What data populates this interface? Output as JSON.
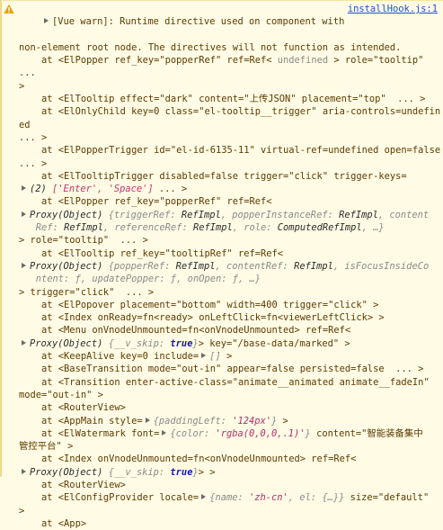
{
  "warning": {
    "line1": "[Vue warn]: Runtime directive used on component with",
    "source_link": "installHook.js:1",
    "line2": "non-element root node. The directives will not function as intended."
  },
  "trace": {
    "r1_pre": "at <ElPopper ref_key=\"popperRef\" ref=Ref< ",
    "r1_und": "undefined",
    "r1_post": " > role=\"tooltip\"  ...",
    "r1_cont": ">",
    "r2": "at <ElTooltip effect=\"dark\" content=\"上传JSON\" placement=\"top\"  ... >",
    "r3a": "at <ElOnlyChild key=0 class=\"el-tooltip__trigger\" aria-controls=undefined",
    "r3b": "... >",
    "r4a": "at <ElPopperTrigger id=\"el-id-6135-11\" virtual-ref=undefined open=false",
    "r4b": "... >",
    "r5a": "at <ElTooltipTrigger disabled=false trigger=\"click\" trigger-keys=",
    "r5_count": "(2)",
    "r5_items": "['Enter', 'Space']",
    "r5_post": " ... >",
    "r6": "at <ElPopper ref_key=\"popperRef\" ref=Ref<",
    "r6_proxy": "Proxy(Object)",
    "r6_o1": "{triggerRef: ",
    "r6_o1v": "RefImpl",
    "r6_o2": ", popperInstanceRef: ",
    "r6_o2v": "RefImpl",
    "r6_o3": ", content",
    "r6_o4": "Ref: ",
    "r6_o4v": "RefImpl",
    "r6_o5": ", referenceRef: ",
    "r6_o5v": "RefImpl",
    "r6_o6": ", role: ",
    "r6_o6v": "ComputedRefImpl",
    "r6_o7": ", …}",
    "r6_post": "> role=\"tooltip\"  ... >",
    "r7": "at <ElTooltip ref_key=\"tooltipRef\" ref=Ref<",
    "r7_proxy": "Proxy(Object)",
    "r7_o1": "{popperRef: ",
    "r7_o1v": "RefImpl",
    "r7_o2": ", contentRef: ",
    "r7_o2v": "RefImpl",
    "r7_o3": ", isFocusInsideCo",
    "r7_o4": "ntent: ƒ, updatePopper: ƒ, onOpen: ƒ, …}",
    "r7_post": "> trigger=\"click\"  ... >",
    "r8": "at <ElPopover placement=\"bottom\" width=400 trigger=\"click\" >",
    "r9": "at <Index onReady=fn<ready> onLeftClick=fn<viewerLeftClick> >",
    "r10": "at <Menu onVnodeUnmounted=fn<onVnodeUnmounted> ref=Ref<",
    "r10_proxy": "Proxy(Object)",
    "r10_o1": "{__v_skip: ",
    "r10_o1v": "true",
    "r10_o2": "}",
    "r10_post": "> key=\"/base-data/marked\" >",
    "r11_pre": "at <KeepAlive key=0 include=",
    "r11_arr": "[]",
    "r11_post": " >",
    "r12": "at <BaseTransition mode=\"out-in\" appear=false persisted=false  ... >",
    "r13a": "at <Transition enter-active-class=\"animate__animated animate__fadeIn\"",
    "r13b": "mode=\"out-in\" >",
    "r14": "at <RouterView>",
    "r15_pre": "at <AppMain style=",
    "r15_o1": "{paddingLeft: ",
    "r15_o1v": "'124px'",
    "r15_o2": "}",
    "r15_post": " >",
    "r16_pre": "at <ElWatermark font=",
    "r16_o1": "{color: ",
    "r16_o1v": "'rgba(0,0,0,.1)'",
    "r16_o2": "}",
    "r16_post": " content=\"智能装备集中",
    "r16b": "管控平台\" >",
    "r17": "at <Index onVnodeUnmounted=fn<onVnodeUnmounted> ref=Ref<",
    "r17_proxy": "Proxy(Object)",
    "r17_o1": "{__v_skip: ",
    "r17_o1v": "true",
    "r17_o2": "}",
    "r17_post": "> >",
    "r18": "at <RouterView>",
    "r19_pre": "at <ElConfigProvider locale=",
    "r19_o1": "{name: ",
    "r19_o1v": "'zh-cn'",
    "r19_o2": ", el: {…}}",
    "r19_post": " size=\"default\"",
    "r19b": ">",
    "r20": "at <App>"
  },
  "colors": {
    "background": "#fffbe5",
    "text": "#5c3b00",
    "link": "#1a4fd0",
    "warn_icon": "#e6a000"
  },
  "icons": {
    "warning": "warning-triangle-icon",
    "expand": "expand-triangle-icon"
  }
}
